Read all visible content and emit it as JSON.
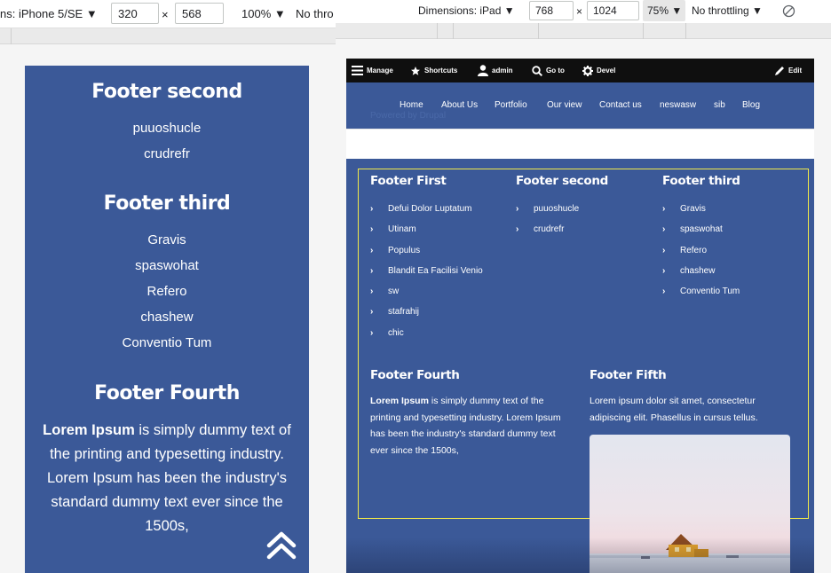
{
  "left_toolbar": {
    "device_label": "ns: iPhone 5/SE ▼",
    "width": "320",
    "times": "×",
    "height": "568",
    "zoom": "100% ▼",
    "throttle": "No thro"
  },
  "phone": {
    "footer_second": {
      "title": "Footer second",
      "links": [
        "puuoshucle",
        "crudrefr"
      ]
    },
    "footer_third": {
      "title": "Footer third",
      "links": [
        "Gravis",
        "spaswohat",
        "Refero",
        "chashew",
        "Conventio Tum"
      ]
    },
    "footer_fourth": {
      "title": "Footer Fourth",
      "bold": "Lorem Ipsum",
      "text": " is simply dummy text of the printing and typesetting industry. Lorem Ipsum has been the industry's standard dummy text ever since the 1500s,"
    },
    "scroll_top_icon": "double-chevron-up-icon"
  },
  "right_toolbar": {
    "device_label": "Dimensions: iPad ▼",
    "width": "768",
    "times": "×",
    "height": "1024",
    "zoom": "75% ▼",
    "throttle": "No throttling ▼",
    "rotate_icon": "rotate-icon"
  },
  "admin_bar": {
    "items": [
      {
        "label": "Manage",
        "icon": "menu-icon"
      },
      {
        "label": "Shortcuts",
        "icon": "star-icon"
      },
      {
        "label": "admin",
        "icon": "user-icon"
      },
      {
        "label": "Go to",
        "icon": "search-icon"
      },
      {
        "label": "Devel",
        "icon": "gear-icon"
      }
    ],
    "edit": {
      "label": "Edit",
      "icon": "pencil-icon"
    }
  },
  "nav": {
    "items": [
      "Home",
      "About Us",
      "Portfolio",
      "Our view",
      "Contact us",
      "neswasw",
      "sib",
      "Blog"
    ],
    "powered_by": "Powered by Drupal"
  },
  "footer": {
    "first": {
      "title": "Footer First",
      "links": [
        "Defui Dolor Luptatum",
        "Utinam",
        "Populus",
        "Blandit Ea Facilisi Venio",
        "sw",
        "stafrahij",
        "chic"
      ]
    },
    "second": {
      "title": "Footer second",
      "links": [
        "puuoshucle",
        "crudrefr"
      ]
    },
    "third": {
      "title": "Footer third",
      "links": [
        "Gravis",
        "spaswohat",
        "Refero",
        "chashew",
        "Conventio Tum"
      ]
    },
    "fourth": {
      "title": "Footer Fourth",
      "bold": "Lorem Ipsum",
      "text": " is simply dummy text of the printing and typesetting industry. Lorem Ipsum has been the industry's standard dummy text ever since the 1500s,"
    },
    "fifth": {
      "title": "Footer Fifth",
      "text": "Lorem ipsum dolor sit amet, consectetur adipiscing elit. Phasellus in cursus tellus."
    },
    "chevron": "›"
  },
  "colors": {
    "brand_blue": "#3b5998",
    "admin_bar": "#0f0f0f",
    "highlight_outline": "#f0e84a"
  }
}
